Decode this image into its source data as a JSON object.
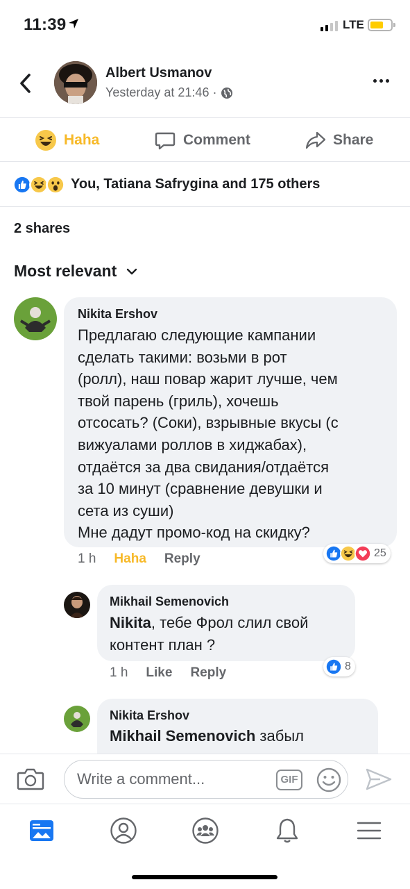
{
  "status_bar": {
    "time": "11:39",
    "network": "LTE",
    "battery_percent": 50
  },
  "header": {
    "author": "Albert Usmanov",
    "timestamp": "Yesterday at 21:46 ·"
  },
  "actions": {
    "haha_label": "Haha",
    "comment_label": "Comment",
    "share_label": "Share"
  },
  "reactions": {
    "summary": "You, Tatiana Safrygina and 175 others",
    "types": [
      "like-icon",
      "haha-icon",
      "wow-icon"
    ]
  },
  "shares": "2 shares",
  "sort": {
    "label": "Most relevant"
  },
  "comments": [
    {
      "author": "Nikita Ershov",
      "lines": [
        "Предлагаю следующие кампании",
        "сделать такими: возьми в рот",
        "(ролл), наш повар жарит лучше, чем",
        "твой парень (гриль), хочешь",
        "отсосать? (Соки), взрывные вкусы (с",
        "вижуалами роллов в хиджабах),",
        "отдаётся за два свидания/отдаётся",
        "за 10 минут (сравнение девушки и",
        "сета из суши)",
        "Мне дадут промо-код на скидку?"
      ],
      "time": "1 h",
      "reaction_label": "Haha",
      "reply_label": "Reply",
      "reaction_count": "25"
    },
    {
      "author": "Mikhail Semenovich",
      "mention": "Nikita",
      "line1_rest": ", тебе Фрол слил свой",
      "line2": "контент план ?",
      "time": "1 h",
      "reaction_label": "Like",
      "reply_label": "Reply",
      "reaction_count": "8"
    },
    {
      "author": "Nikita Ershov",
      "mention": "Mikhail Semenovich",
      "text_rest": " забыл"
    }
  ],
  "composer": {
    "placeholder": "Write a comment...",
    "gif_label": "GIF"
  },
  "tabs": [
    "news-feed-icon",
    "profile-icon",
    "groups-icon",
    "notifications-icon",
    "menu-icon"
  ],
  "colors": {
    "accent": "#1877f2",
    "haha": "#f7b928",
    "muted": "#65676b",
    "bubble": "#f0f2f5"
  }
}
